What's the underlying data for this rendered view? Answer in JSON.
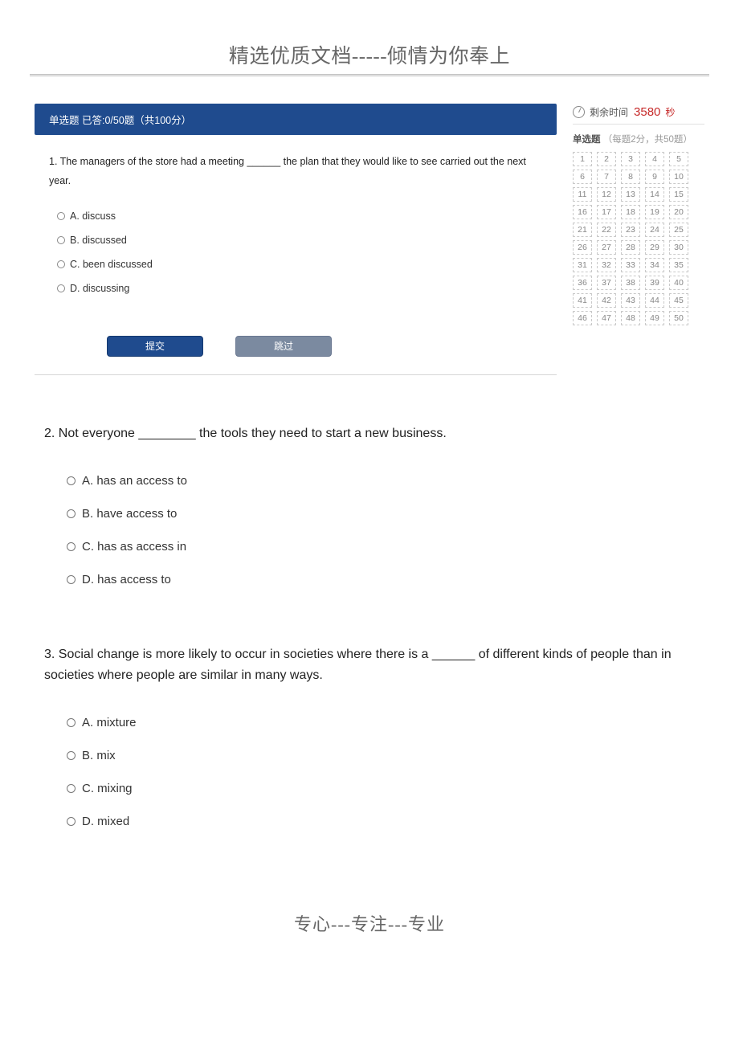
{
  "header_title": "精选优质文档-----倾情为你奉上",
  "exam_bar": "单选题 已答:0/50题（共100分）",
  "timer": {
    "label": "剩余时间",
    "value": "3580",
    "unit": "秒"
  },
  "nav_section": {
    "label": "单选题",
    "meta": "（每题2分，共50题）",
    "count": 50
  },
  "q1": {
    "stem": "1. The managers of the store had a meeting ______ the plan that they would like to see carried out the next year.",
    "choices": [
      "A. discuss",
      "B. discussed",
      "C. been discussed",
      "D. discussing"
    ]
  },
  "buttons": {
    "submit": "提交",
    "skip": "跳过"
  },
  "q2": {
    "stem": "2. Not everyone ________ the tools they need to start a new business.",
    "choices": [
      "A. has an access to",
      "B. have access to",
      "C. has as access in",
      "D. has access to"
    ]
  },
  "q3": {
    "stem": "3. Social change is more likely to occur in societies where there is a ______ of different kinds of people than in societies where people are similar in many ways.",
    "choices": [
      "A. mixture",
      "B. mix",
      "C. mixing",
      "D. mixed"
    ]
  },
  "footer": "专心---专注---专业"
}
